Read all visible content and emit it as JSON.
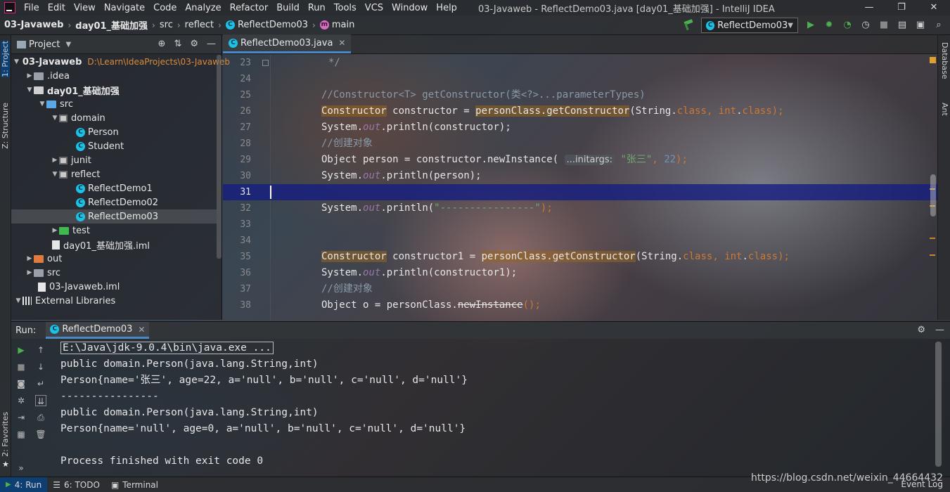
{
  "menubar": {
    "items": [
      "File",
      "Edit",
      "View",
      "Navigate",
      "Code",
      "Analyze",
      "Refactor",
      "Build",
      "Run",
      "Tools",
      "VCS",
      "Window",
      "Help"
    ],
    "window_title": "03-Javaweb - ReflectDemo03.java [day01_基础加强] - IntelliJ IDEA",
    "controls": [
      "—",
      "❐",
      "✕"
    ]
  },
  "navbar": {
    "crumbs": [
      "03-Javaweb",
      "day01_基础加强",
      "src",
      "reflect",
      "ReflectDemo03",
      "main"
    ],
    "run_config": "ReflectDemo03"
  },
  "left_strip": {
    "project": "1: Project",
    "structure": "Z: Structure",
    "favorites": "2: Favorites"
  },
  "right_strip": {
    "database": "Database",
    "ant": "Ant"
  },
  "project_panel": {
    "title": "Project",
    "root_name": "03-Javaweb",
    "root_path": "D:\\Learn\\IdeaProjects\\03-Javaweb",
    "nodes": {
      "idea": ".idea",
      "day01": "day01_基础加强",
      "src": "src",
      "domain": "domain",
      "person": "Person",
      "student": "Student",
      "junit": "junit",
      "reflect": "reflect",
      "rd1": "ReflectDemo1",
      "rd2": "ReflectDemo02",
      "rd3": "ReflectDemo03",
      "test": "test",
      "iml": "day01_基础加强.iml",
      "out": "out",
      "src2": "src",
      "rootiml": "03-Javaweb.iml",
      "libs": "External Libraries"
    }
  },
  "editor": {
    "tab": "ReflectDemo03.java",
    "lines": {
      "l23": {
        "num": "23",
        "text": "*/"
      },
      "l24": {
        "num": "24"
      },
      "l25": {
        "num": "25",
        "text": "//Constructor<T> getConstructor(类<?>...parameterTypes)"
      },
      "l26": {
        "num": "26",
        "a": "Constructor",
        "b": " constructor = ",
        "c": "personClass.getConstructor",
        "d": "(String.",
        "e": "class",
        "f": ", ",
        "g": "int",
        "h": ".",
        "i": "class",
        "j": ");"
      },
      "l27": {
        "num": "27",
        "a": "System.",
        "b": "out",
        "c": ".println(constructor);"
      },
      "l28": {
        "num": "28",
        "text": "//创建对象"
      },
      "l29": {
        "num": "29",
        "a": "Object person = constructor.newInstance( ",
        "hint": "...initargs:",
        "s": " \"张三\"",
        "c": ", ",
        "n": "22",
        "e": ");"
      },
      "l30": {
        "num": "30",
        "a": "System.",
        "b": "out",
        "c": ".println(person);"
      },
      "l31": {
        "num": "31"
      },
      "l32": {
        "num": "32",
        "a": "System.",
        "b": "out",
        "c": ".println(",
        "s": "\"----------------\"",
        "e": ");"
      },
      "l33": {
        "num": "33"
      },
      "l34": {
        "num": "34"
      },
      "l35": {
        "num": "35",
        "a": "Constructor",
        "b": " constructor1 = ",
        "c": "personClass.getConstructor",
        "d": "(String.",
        "e": "class",
        "f": ", ",
        "g": "int",
        "h": ".",
        "i": "class",
        "j": ");"
      },
      "l36": {
        "num": "36",
        "a": "System.",
        "b": "out",
        "c": ".println(constructor1);"
      },
      "l37": {
        "num": "37",
        "text": "//创建对象"
      },
      "l38": {
        "num": "38",
        "a": "Object o = personClass.",
        "b": "newInstance",
        "c": "();"
      }
    }
  },
  "run_panel": {
    "title": "Run:",
    "tab": "ReflectDemo03",
    "output": [
      "E:\\Java\\jdk-9.0.4\\bin\\java.exe ...",
      "public domain.Person(java.lang.String,int)",
      "Person{name='张三', age=22, a='null', b='null', c='null', d='null'}",
      "----------------",
      "public domain.Person(java.lang.String,int)",
      "Person{name='null', age=0, a='null', b='null', c='null', d='null'}",
      "",
      "Process finished with exit code 0"
    ]
  },
  "statusbar": {
    "run": "4: Run",
    "todo": "6: TODO",
    "terminal": "Terminal",
    "event_log": "Event Log",
    "watermark": "https://blog.csdn.net/weixin_44664432"
  },
  "colors": {
    "keyword": "#cc7832",
    "string": "#6aab73",
    "number": "#6897bb",
    "static_field": "#9876aa",
    "comment": "#8a99a8",
    "current_line": "#141c82",
    "accent": "#4a88c7"
  }
}
